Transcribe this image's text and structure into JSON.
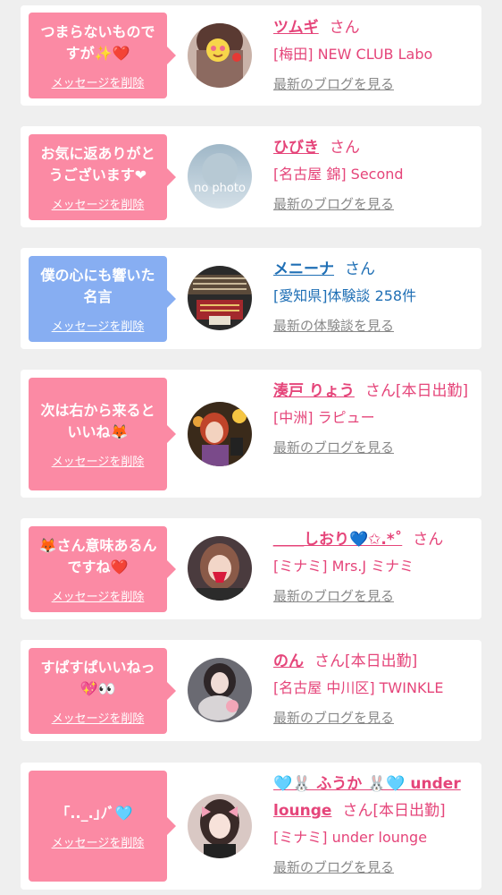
{
  "accent_pink": "#fb8aa4",
  "accent_blue": "#87aef2",
  "name_pink": "#e5457a",
  "name_blue": "#1f6fb5",
  "cards": [
    {
      "message": "つまらないものですが✨❤️",
      "delete": "メッセージを削除",
      "name": "ツムギ",
      "suffix": "さん",
      "status": "",
      "shop": "[梅田] NEW CLUB Labo",
      "link": "最新のブログを見る"
    },
    {
      "message": "お気に返ありがとうございます❤",
      "delete": "メッセージを削除",
      "name": "ひびき",
      "suffix": "さん",
      "status": "",
      "shop": "[名古屋 錦] Second",
      "link": "最新のブログを見る",
      "avatar_text": "no photo"
    },
    {
      "message": "僕の心にも響いた名言",
      "delete": "メッセージを削除",
      "name": "メニーナ",
      "suffix": "さん",
      "status": "",
      "shop": "[愛知県]体験談 258件",
      "link": "最新の体験談を見る"
    },
    {
      "message": "次は右から来るといいね🦊",
      "delete": "メッセージを削除",
      "name": "湊戸 りょう",
      "suffix": "さん",
      "status": "[本日出勤]",
      "shop": "[中洲] ラピュー",
      "link": "最新のブログを見る"
    },
    {
      "message": "🦊さん意味あるんですね❤️",
      "delete": "メッセージを削除",
      "name": "＿＿しおり💙✩.*˚",
      "suffix": "さん",
      "status": "",
      "shop": "[ミナミ] Mrs.J ミナミ",
      "link": "最新のブログを見る"
    },
    {
      "message": "すぱすぱいいねっ💖👀",
      "delete": "メッセージを削除",
      "name": "のん",
      "suffix": "さん",
      "status": "[本日出勤]",
      "shop": "[名古屋 中川区] TWINKLE",
      "link": "最新のブログを見る"
    },
    {
      "message": "｢.._.｣ﾉﾞ🩵",
      "delete": "メッセージを削除",
      "name": "🩵🐰 ふうか 🐰🩵 under lounge",
      "suffix": "さん",
      "status": "[本日出勤]",
      "shop": "[ミナミ] under lounge",
      "link": "最新のブログを見る"
    }
  ]
}
